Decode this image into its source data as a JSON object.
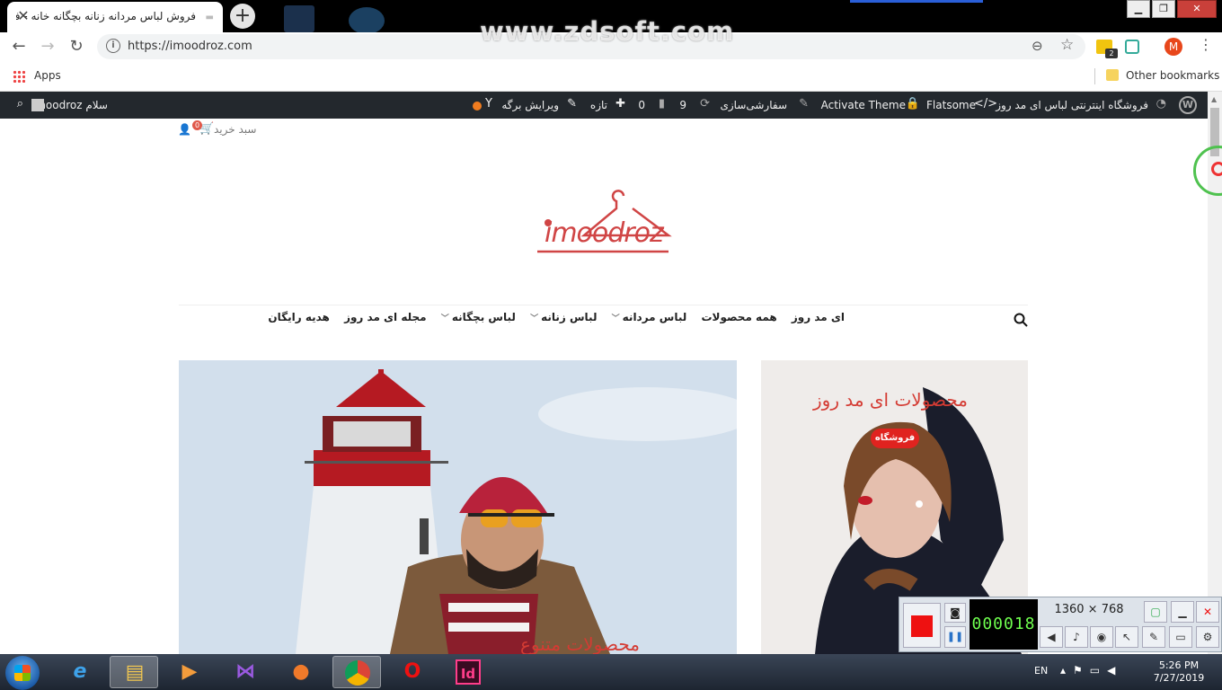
{
  "browser": {
    "tab_title": "فروش لباس مردانه زنانه بچگانه خانه - فروش",
    "url": "https://imoodroz.com",
    "watermark": "www.zdsoft.com",
    "profile_initial": "M",
    "extension_badge": "2",
    "bookmarks": {
      "apps_label": "Apps",
      "other_label": "Other bookmarks"
    }
  },
  "wp_admin_bar": {
    "site_name": "فروشگاه اینترنتی لباس ای مد روز",
    "theme": "Flatsome",
    "activate_theme": "Activate Theme",
    "customize": "سفارشی‌سازی",
    "updates_count": "9",
    "comments_count": "0",
    "new_label": "تازه",
    "edit_page": "ویرایش برگه",
    "greeting": "سلام imoodroz"
  },
  "site": {
    "cart_label": "سبد خرید",
    "cart_count": "0",
    "logo_text": "imoodroz",
    "nav": [
      {
        "label": "ای مد روز",
        "dropdown": false
      },
      {
        "label": "همه محصولات",
        "dropdown": false
      },
      {
        "label": "لباس مردانه",
        "dropdown": true
      },
      {
        "label": "لباس زنانه",
        "dropdown": true
      },
      {
        "label": "لباس بچگانه",
        "dropdown": true
      },
      {
        "label": "مجله ای مد روز",
        "dropdown": false
      },
      {
        "label": "هدیه رایگان",
        "dropdown": false
      }
    ],
    "banner_right": {
      "title": "محصولات ای مد روز",
      "button": "فروشگاه"
    },
    "banner_left": {
      "caption": "محصولات متنوع"
    }
  },
  "recorder": {
    "timer": "000018",
    "dimensions": "1360 × 768"
  },
  "taskbar": {
    "language": "EN",
    "time": "5:26 PM",
    "date": "7/27/2019"
  },
  "colors": {
    "accent_red": "#d43b33",
    "wp_bar": "#23282d",
    "button_red": "#e0231f"
  }
}
